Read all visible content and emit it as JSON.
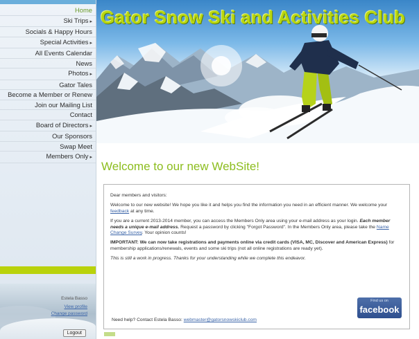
{
  "sidebar": {
    "items": [
      {
        "label": "Home",
        "arrow": ""
      },
      {
        "label": "Ski Trips",
        "arrow": "▸"
      },
      {
        "label": "Socials & Happy Hours",
        "arrow": ""
      },
      {
        "label": "Special Activities",
        "arrow": "▸"
      },
      {
        "label": "All Events Calendar",
        "arrow": ""
      },
      {
        "label": "News",
        "arrow": ""
      },
      {
        "label": "Photos",
        "arrow": "▸"
      },
      {
        "label": "Gator Tales",
        "arrow": ""
      },
      {
        "label": "Become a Member or Renew",
        "arrow": ""
      },
      {
        "label": "Join our Mailing List",
        "arrow": ""
      },
      {
        "label": "Contact",
        "arrow": ""
      },
      {
        "label": "Board of Directors",
        "arrow": "▸"
      },
      {
        "label": "Our Sponsors",
        "arrow": ""
      },
      {
        "label": "Swap Meet",
        "arrow": ""
      },
      {
        "label": "Members Only",
        "arrow": "▸"
      }
    ],
    "member": {
      "name": "Estela Basso",
      "view_profile": "View profile",
      "change_password": "Change password",
      "logout": "Logout"
    }
  },
  "header": {
    "title": "Gator Snow Ski and Activities Club"
  },
  "main": {
    "welcome": "Welcome to our new WebSite!",
    "greeting": "Dear members and visitors:",
    "p1_before": "Welcome to our new website! We hope you like it and helps you find the information you need in an efficient manner. We welcome your ",
    "p1_link": "feedback",
    "p1_after": " at any time.",
    "p2_a": "If you are a current 2013-2014 member, you can access the Members Only area using your e-mail address as your login. ",
    "p2_b": "Each member needs a unique e-mail address.",
    "p2_c": " Request a password by clicking \"Forgot Password\". In the Members Only area, please take the ",
    "p2_link": "Name Change Survey",
    "p2_d": ". Your opinion counts!",
    "p3_bold": "IMPORTANT: We can now take registrations and payments online via credit cards (VISA, MC, Discover and American Express)",
    "p3_rest": " for membership applications/renewals, events and some ski trips (not all online registrations are ready yet).",
    "p4": "This is still a work in progress. Thanks for your understanding while we complete this endeavor.",
    "help_text": "Need help? Contact Estela Basso: ",
    "help_email": "webmaster@gatorsnowskiclub.com",
    "facebook_small": "Find us on",
    "facebook_big": "facebook"
  },
  "colors": {
    "title_green": "#b9d70f",
    "welcome_green": "#8cbd1e",
    "sidebar_bg": "#e3ebf3",
    "link_blue": "#3a64a8",
    "facebook_blue": "#3b5998"
  }
}
